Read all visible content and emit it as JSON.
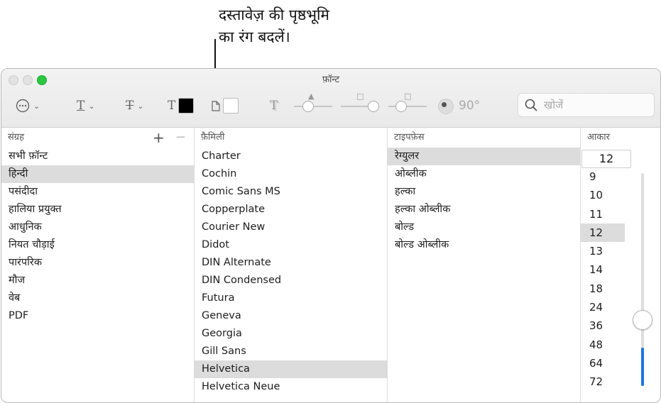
{
  "callout": {
    "text": "दस्तावेज़ की पृष्ठभूमि\nका रंग बदलें।"
  },
  "window": {
    "title": "फ़ॉन्ट"
  },
  "toolbar": {
    "action_icon": "ellipsis-circle-icon",
    "text_color": "#000000",
    "document_color": "#ffffff",
    "shadow_angle": "90°"
  },
  "search": {
    "placeholder": "खोजें",
    "value": ""
  },
  "columns": {
    "collections_header": "संग्रह",
    "family_header": "फ़ैमिली",
    "typeface_header": "टाइपफ़ेस",
    "size_header": "आकार"
  },
  "collections": [
    "सभी फ़ॉन्ट",
    "हिन्दी",
    "पसंदीदा",
    "हालिया प्रयुक्त",
    "आधुनिक",
    "नियत चौड़ाई",
    "पारंपरिक",
    "मौज",
    "वेब",
    "PDF"
  ],
  "collections_selected": 1,
  "families": [
    "Charter",
    "Cochin",
    "Comic Sans MS",
    "Copperplate",
    "Courier New",
    "Didot",
    "DIN Alternate",
    "DIN Condensed",
    "Futura",
    "Geneva",
    "Georgia",
    "Gill Sans",
    "Helvetica",
    "Helvetica Neue"
  ],
  "families_selected": 12,
  "typefaces": [
    "रेग्युलर",
    "ओब्लीक",
    "हल्का",
    "हल्का ओब्लीक",
    "बोल्ड",
    "बोल्ड ओब्लीक"
  ],
  "typefaces_selected": 0,
  "size": {
    "value": "12",
    "options": [
      "9",
      "10",
      "11",
      "12",
      "13",
      "14",
      "18",
      "24",
      "36",
      "48",
      "64",
      "72"
    ],
    "selected": 3,
    "slider_fraction": 0.18,
    "accent": "#1a73e8"
  }
}
